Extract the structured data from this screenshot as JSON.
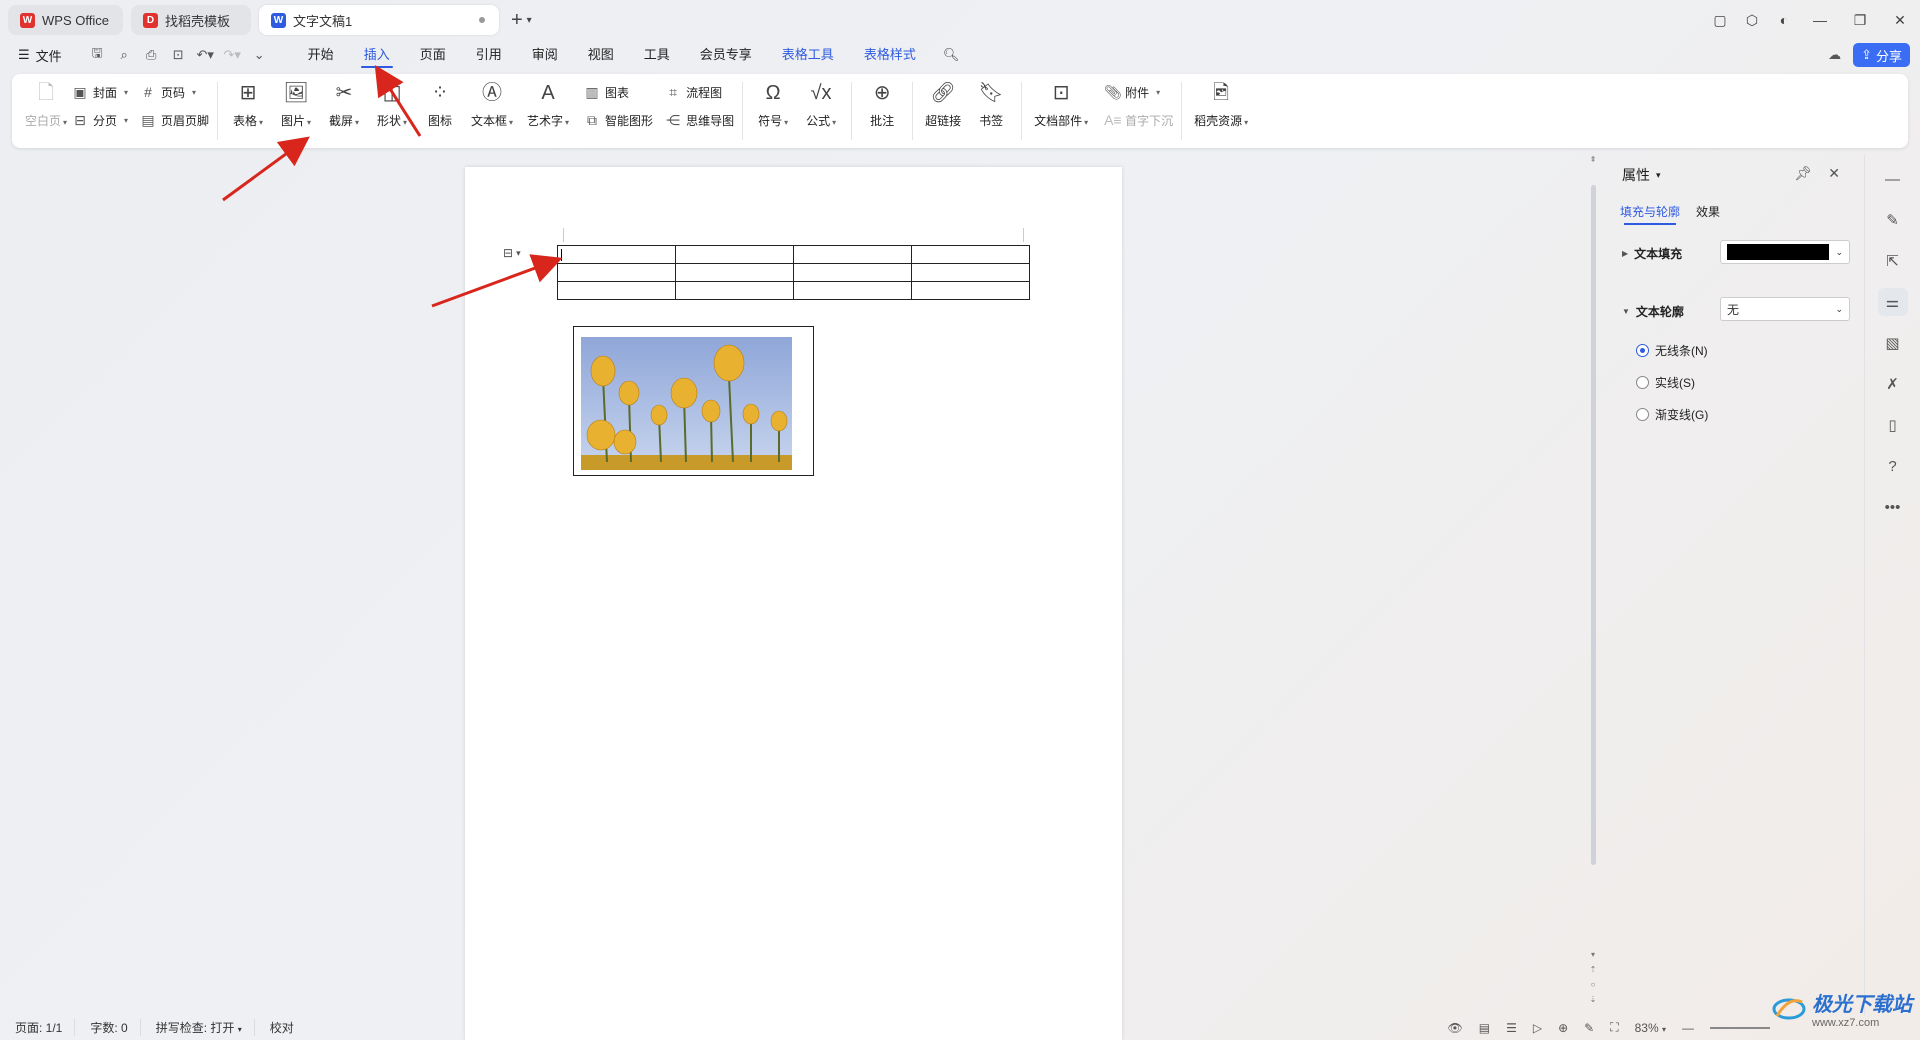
{
  "tabs": [
    {
      "label": "WPS Office",
      "icon": "wps-logo-icon",
      "color": "#e0322e"
    },
    {
      "label": "找稻壳模板",
      "icon": "docer-logo-icon",
      "color": "#e0322e"
    },
    {
      "label": "文字文稿1",
      "icon": "writer-doc-icon",
      "color": "#2f5be0"
    }
  ],
  "menu": {
    "file": "文件",
    "items": [
      "开始",
      "插入",
      "页面",
      "引用",
      "审阅",
      "视图",
      "工具",
      "会员专享"
    ],
    "active": "插入",
    "context_items": [
      "表格工具",
      "表格样式"
    ],
    "share": "分享"
  },
  "ribbon": {
    "blank_page": "空白页",
    "cover": "封面",
    "page_break": "分页",
    "page_number": "页码",
    "header_footer": "页眉页脚",
    "table": "表格",
    "picture": "图片",
    "screenshot": "截屏",
    "shape": "形状",
    "icons": "图标",
    "textbox": "文本框",
    "wordart": "艺术字",
    "chart": "图表",
    "smartart": "智能图形",
    "flowchart": "流程图",
    "mindmap": "思维导图",
    "symbol": "符号",
    "formula": "公式",
    "comment": "批注",
    "hyperlink": "超链接",
    "bookmark": "书签",
    "doc_parts": "文档部件",
    "attachment": "附件",
    "dropcap": "首字下沉",
    "docer_resources": "稻壳资源"
  },
  "pane": {
    "title": "属性",
    "tab_fill_outline": "填充与轮廓",
    "tab_effects": "效果",
    "text_fill_label": "文本填充",
    "text_fill_color": "#000000",
    "text_outline_label": "文本轮廓",
    "text_outline_value": "无",
    "radio_none": "无线条(N)",
    "radio_solid": "实线(S)",
    "radio_gradient": "渐变线(G)",
    "selected": "无线条(N)"
  },
  "status": {
    "page": "页面: 1/1",
    "words": "字数: 0",
    "spellcheck": "拼写检查: 打开",
    "proof": "校对",
    "zoom": "83%"
  },
  "watermark": {
    "title": "极光下载站",
    "url": "www.xz7.com"
  },
  "accent_color": "#2f5be0",
  "arrow_color": "#d9261c"
}
